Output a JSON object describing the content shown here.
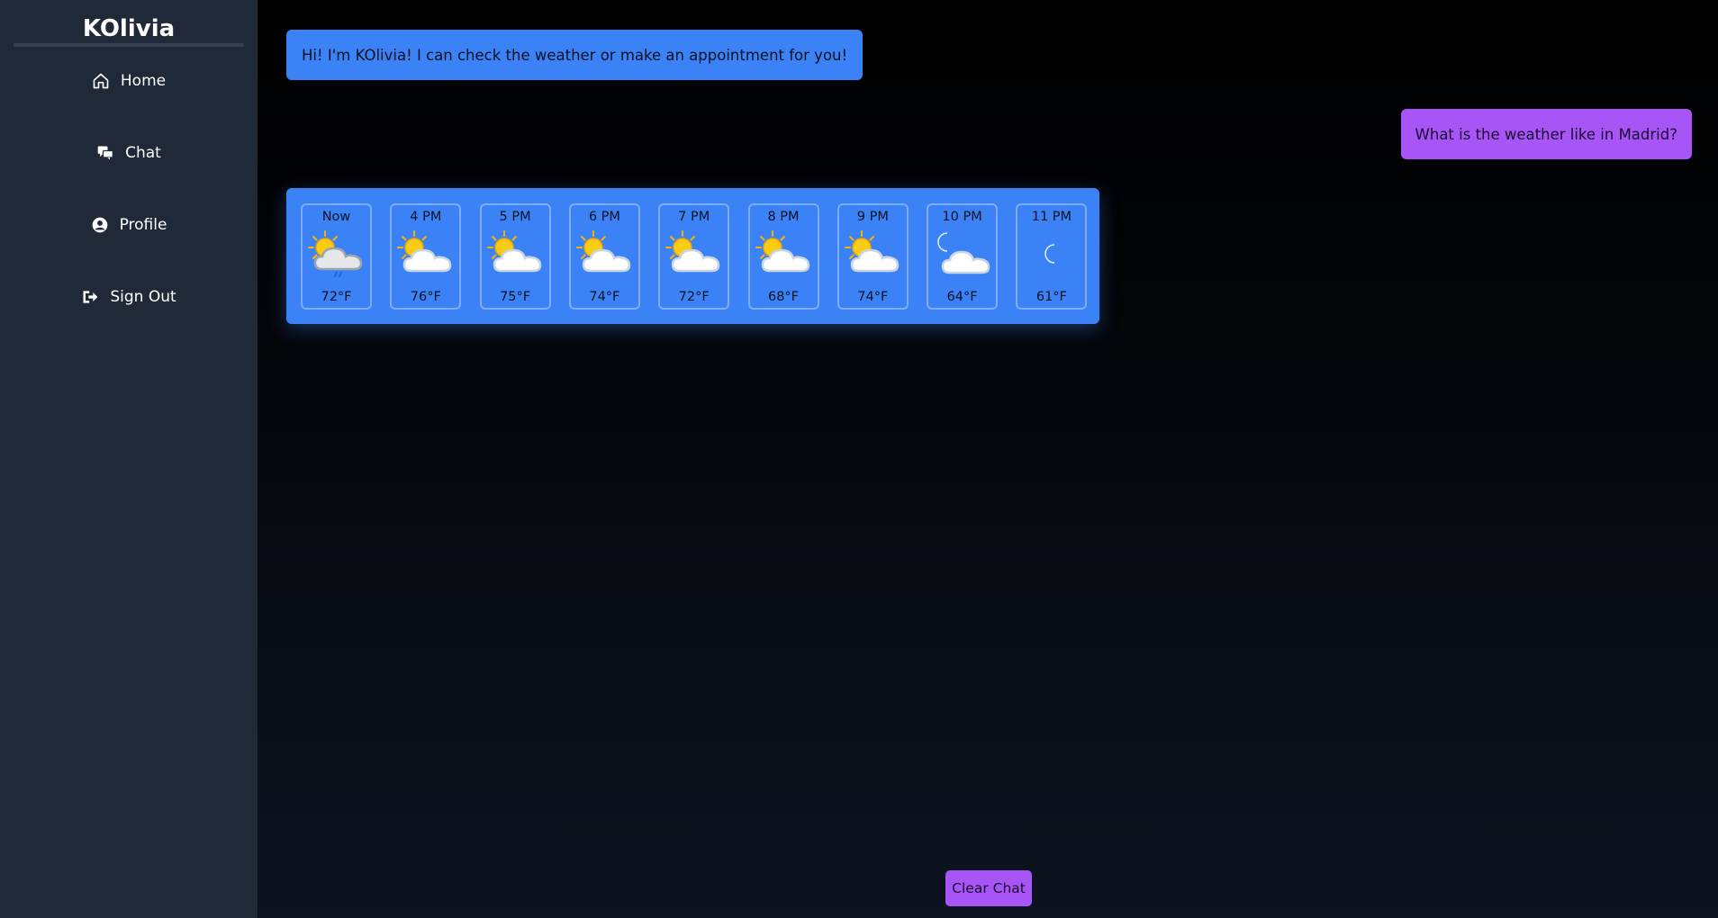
{
  "sidebar": {
    "brand": "KOlivia",
    "items": [
      {
        "label": "Home",
        "icon": "home-icon"
      },
      {
        "label": "Chat",
        "icon": "chat-icon"
      },
      {
        "label": "Profile",
        "icon": "profile-icon"
      },
      {
        "label": "Sign Out",
        "icon": "sign-out-icon"
      }
    ]
  },
  "chat": {
    "messages": [
      {
        "from": "bot",
        "text": "Hi! I'm KOlivia! I can check the weather or make an appointment for you!"
      },
      {
        "from": "user",
        "text": "What is the weather like in Madrid?"
      }
    ],
    "forecast": [
      {
        "time": "Now",
        "temp": "72°F",
        "icon": "partly-cloudy-rain-icon"
      },
      {
        "time": "4 PM",
        "temp": "76°F",
        "icon": "partly-cloudy-day-icon"
      },
      {
        "time": "5 PM",
        "temp": "75°F",
        "icon": "partly-cloudy-day-icon"
      },
      {
        "time": "6 PM",
        "temp": "74°F",
        "icon": "partly-cloudy-day-icon"
      },
      {
        "time": "7 PM",
        "temp": "72°F",
        "icon": "partly-cloudy-day-icon"
      },
      {
        "time": "8 PM",
        "temp": "68°F",
        "icon": "partly-cloudy-day-icon"
      },
      {
        "time": "9 PM",
        "temp": "74°F",
        "icon": "partly-cloudy-day-icon"
      },
      {
        "time": "10 PM",
        "temp": "64°F",
        "icon": "partly-cloudy-night-icon"
      },
      {
        "time": "11 PM",
        "temp": "61°F",
        "icon": "moon-icon"
      }
    ],
    "clear_label": "Clear Chat"
  },
  "colors": {
    "sidebar_bg": "#1f2937",
    "bot_bubble": "#3b82f6",
    "user_bubble": "#a855f7",
    "sun": "#facc15",
    "moon": "#1e6fd9"
  }
}
